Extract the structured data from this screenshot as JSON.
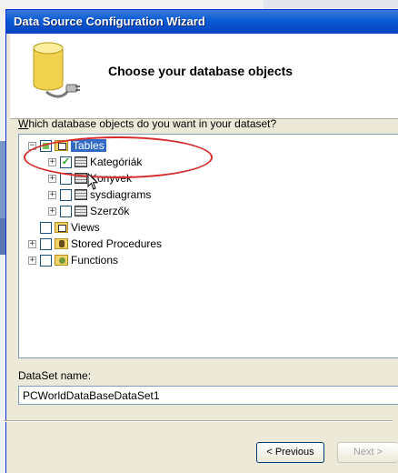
{
  "window": {
    "title": "Data Source Configuration Wizard"
  },
  "header": {
    "heading": "Choose your database objects",
    "icon": "database-connection-icon"
  },
  "question": {
    "prefix": "W",
    "rest": "hich database objects do you want in your dataset?"
  },
  "tree": {
    "tables": {
      "label": "Tables",
      "state": "partial",
      "icon": "folder-table-icon"
    },
    "table_items": [
      {
        "label": "Kategóriák",
        "checked": true
      },
      {
        "label": "Konyvek",
        "checked": false
      },
      {
        "label": "sysdiagrams",
        "checked": false
      },
      {
        "label": "Szerzők",
        "checked": false
      }
    ],
    "views": {
      "label": "Views",
      "icon": "folder-view-icon"
    },
    "procedures": {
      "label": "Stored Procedures",
      "icon": "stored-procedure-icon"
    },
    "functions": {
      "label": "Functions",
      "icon": "function-icon"
    }
  },
  "dataset": {
    "label": "DataSet name:",
    "value": "PCWorldDataBaseDataSet1"
  },
  "buttons": {
    "previous": "< Previous",
    "next": "Next >"
  },
  "colors": {
    "titlebar": "#0a5ad6",
    "highlight": "#d62a2a",
    "selection": "#316ac5"
  }
}
